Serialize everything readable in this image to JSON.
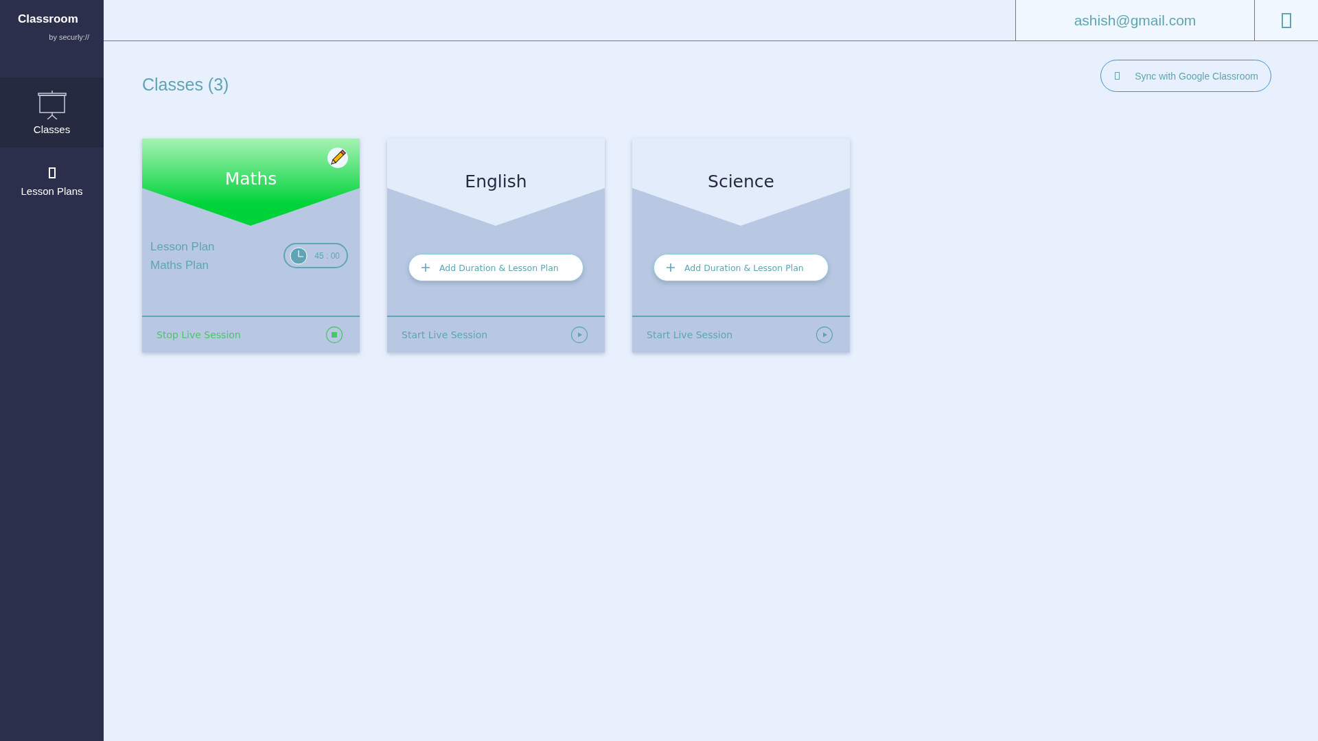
{
  "sidebar": {
    "brand": "Classroom",
    "byline": "by securly://",
    "items": [
      {
        "label": "Classes",
        "kind": "screen",
        "selected": true
      },
      {
        "label": "Lesson Plans",
        "kind": "glyph",
        "selected": false
      }
    ]
  },
  "header": {
    "user_email": "ashish@gmail.com"
  },
  "main": {
    "title": "Classes (3)",
    "sync_button": "Sync with Google Classroom",
    "classes": [
      {
        "name": "Maths",
        "kind": "planned",
        "live": true,
        "lesson_plan_label": "Lesson Plan",
        "lesson_plan": "Maths Plan",
        "duration": "45 : 00",
        "session_action": "Stop Live Session"
      },
      {
        "name": "English",
        "kind": "empty",
        "live": false,
        "add_button": "Add Duration & Lesson Plan",
        "session_action": "Start Live Session"
      },
      {
        "name": "Science",
        "kind": "empty",
        "live": false,
        "add_button": "Add Duration & Lesson Plan",
        "session_action": "Start Live Session"
      }
    ]
  }
}
